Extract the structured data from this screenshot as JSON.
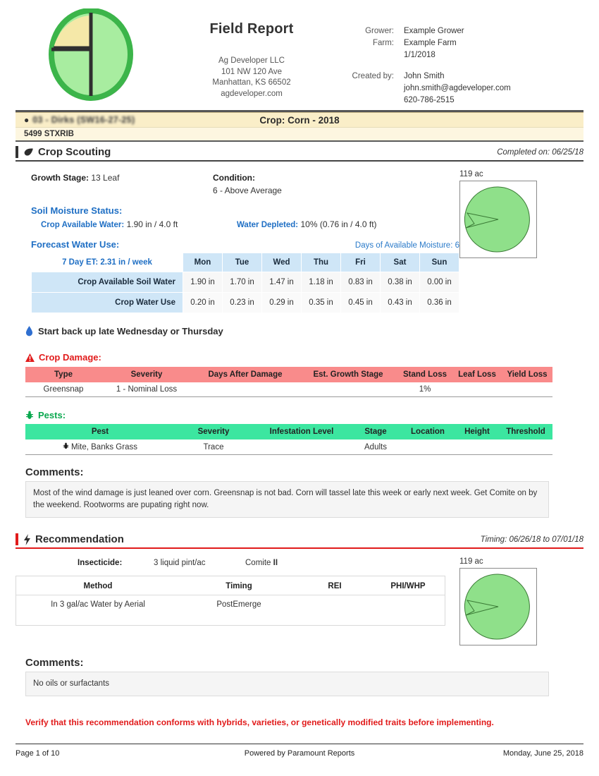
{
  "header": {
    "doc_title": "Field Report",
    "company": [
      "Ag Developer LLC",
      "101 NW 120 Ave",
      "Manhattan, KS 66502",
      "agdeveloper.com"
    ],
    "grower_label": "Grower:",
    "grower_value": "Example Grower",
    "farm_label": "Farm:",
    "farm_value": "Example Farm",
    "farm_date": "1/1/2018",
    "created_label": "Created by:",
    "created_name": "John Smith",
    "created_email": "john.smith@agdeveloper.com",
    "created_phone": "620-786-2515",
    "logo_icon": "circle-quadrant-logo"
  },
  "field_bar": {
    "pin_icon": "map-pin-icon",
    "field_name": "03 - Dirks (SW16-27-25)",
    "crop_title": "Crop: Corn - 2018",
    "variety": "5499 STXRIB"
  },
  "scouting": {
    "icon": "leaf-icon",
    "title": "Crop Scouting",
    "completed_label": "Completed on:",
    "completed_date": "06/25/18",
    "growth_stage_label": "Growth Stage:",
    "growth_stage_value": "13 Leaf",
    "condition_label": "Condition:",
    "condition_value": "6 - Above Average",
    "soil_moisture_title": "Soil Moisture Status:",
    "crop_available_water_label": "Crop Available Water:",
    "crop_available_water_value": "1.90 in / 4.0 ft",
    "water_depleted_label": "Water Depleted:",
    "water_depleted_value": "10% (0.76 in / 4.0 ft)",
    "forecast_title": "Forecast Water Use:",
    "days_available_moisture": "Days of Available Moisture: 6",
    "map_acres": "119 ac",
    "map_icon": "pivot-field-shape"
  },
  "chart_data": {
    "type": "table",
    "title": "Forecast Water Use",
    "corner_label": "7 Day ET: 2.31 in / week",
    "categories": [
      "Mon",
      "Tue",
      "Wed",
      "Thu",
      "Fri",
      "Sat",
      "Sun"
    ],
    "series": [
      {
        "name": "Crop Available Soil Water",
        "values": [
          "1.90 in",
          "1.70 in",
          "1.47 in",
          "1.18 in",
          "0.83 in",
          "0.38 in",
          "0.00 in"
        ]
      },
      {
        "name": "Crop Water Use",
        "values": [
          "0.20 in",
          "0.23 in",
          "0.29 in",
          "0.35 in",
          "0.45 in",
          "0.43 in",
          "0.36 in"
        ]
      }
    ],
    "units": "in",
    "et_total": 2.31,
    "days_of_available_moisture": 6
  },
  "alert": {
    "icon": "water-drop-icon",
    "text": "Start back up late Wednesday or Thursday"
  },
  "crop_damage": {
    "icon": "warning-triangle-icon",
    "title": "Crop Damage:",
    "columns": [
      "Type",
      "Severity",
      "Days After Damage",
      "Est. Growth Stage",
      "Stand Loss",
      "Leaf Loss",
      "Yield Loss"
    ],
    "rows": [
      [
        "Greensnap",
        "1 - Nominal Loss",
        "",
        "",
        "1%",
        "",
        ""
      ]
    ]
  },
  "pests": {
    "icon": "bug-icon",
    "title": "Pests:",
    "columns": [
      "Pest",
      "Severity",
      "Infestation Level",
      "Stage",
      "Location",
      "Height",
      "Threshold"
    ],
    "rows": [
      [
        "Mite, Banks Grass",
        "Trace",
        "",
        "Adults",
        "",
        "",
        ""
      ]
    ],
    "row_icon": "bug-icon"
  },
  "scout_comments": {
    "title": "Comments:",
    "text": "Most of the wind damage is just leaned over corn. Greensnap is not bad. Corn will tassel late this week or early next week. Get Comite on by the weekend. Rootworms are pupating right now."
  },
  "recommendation": {
    "icon": "lightning-bolt-icon",
    "title": "Recommendation",
    "timing_label": "Timing:",
    "timing_value": "06/26/18 to 07/01/18",
    "product_label": "Insecticide:",
    "product_rate": "3 liquid pint/ac",
    "product_name": "Comite ",
    "product_name_bold": "II",
    "columns": [
      "Method",
      "Timing",
      "REI",
      "PHI/WHP"
    ],
    "rows": [
      [
        "In 3 gal/ac Water by Aerial",
        "PostEmerge",
        "",
        ""
      ]
    ],
    "map_acres": "119 ac",
    "map_icon": "pivot-field-shape"
  },
  "rec_comments": {
    "title": "Comments:",
    "text": "No oils or surfactants"
  },
  "warning": "Verify that this recommendation conforms with hybrids, varieties, or genetically modified traits before implementing.",
  "footer": {
    "page": "Page 1 of 10",
    "powered": "Powered by Paramount Reports",
    "date": "Monday, June 25, 2018"
  },
  "colors": {
    "accent_blue": "#1f6fc4",
    "damage_header": "#f98b8b",
    "pest_header": "#3ce6a0",
    "rec_red": "#e11b1b",
    "field_bar": "#faeec8",
    "map_green": "#8fe08a"
  }
}
